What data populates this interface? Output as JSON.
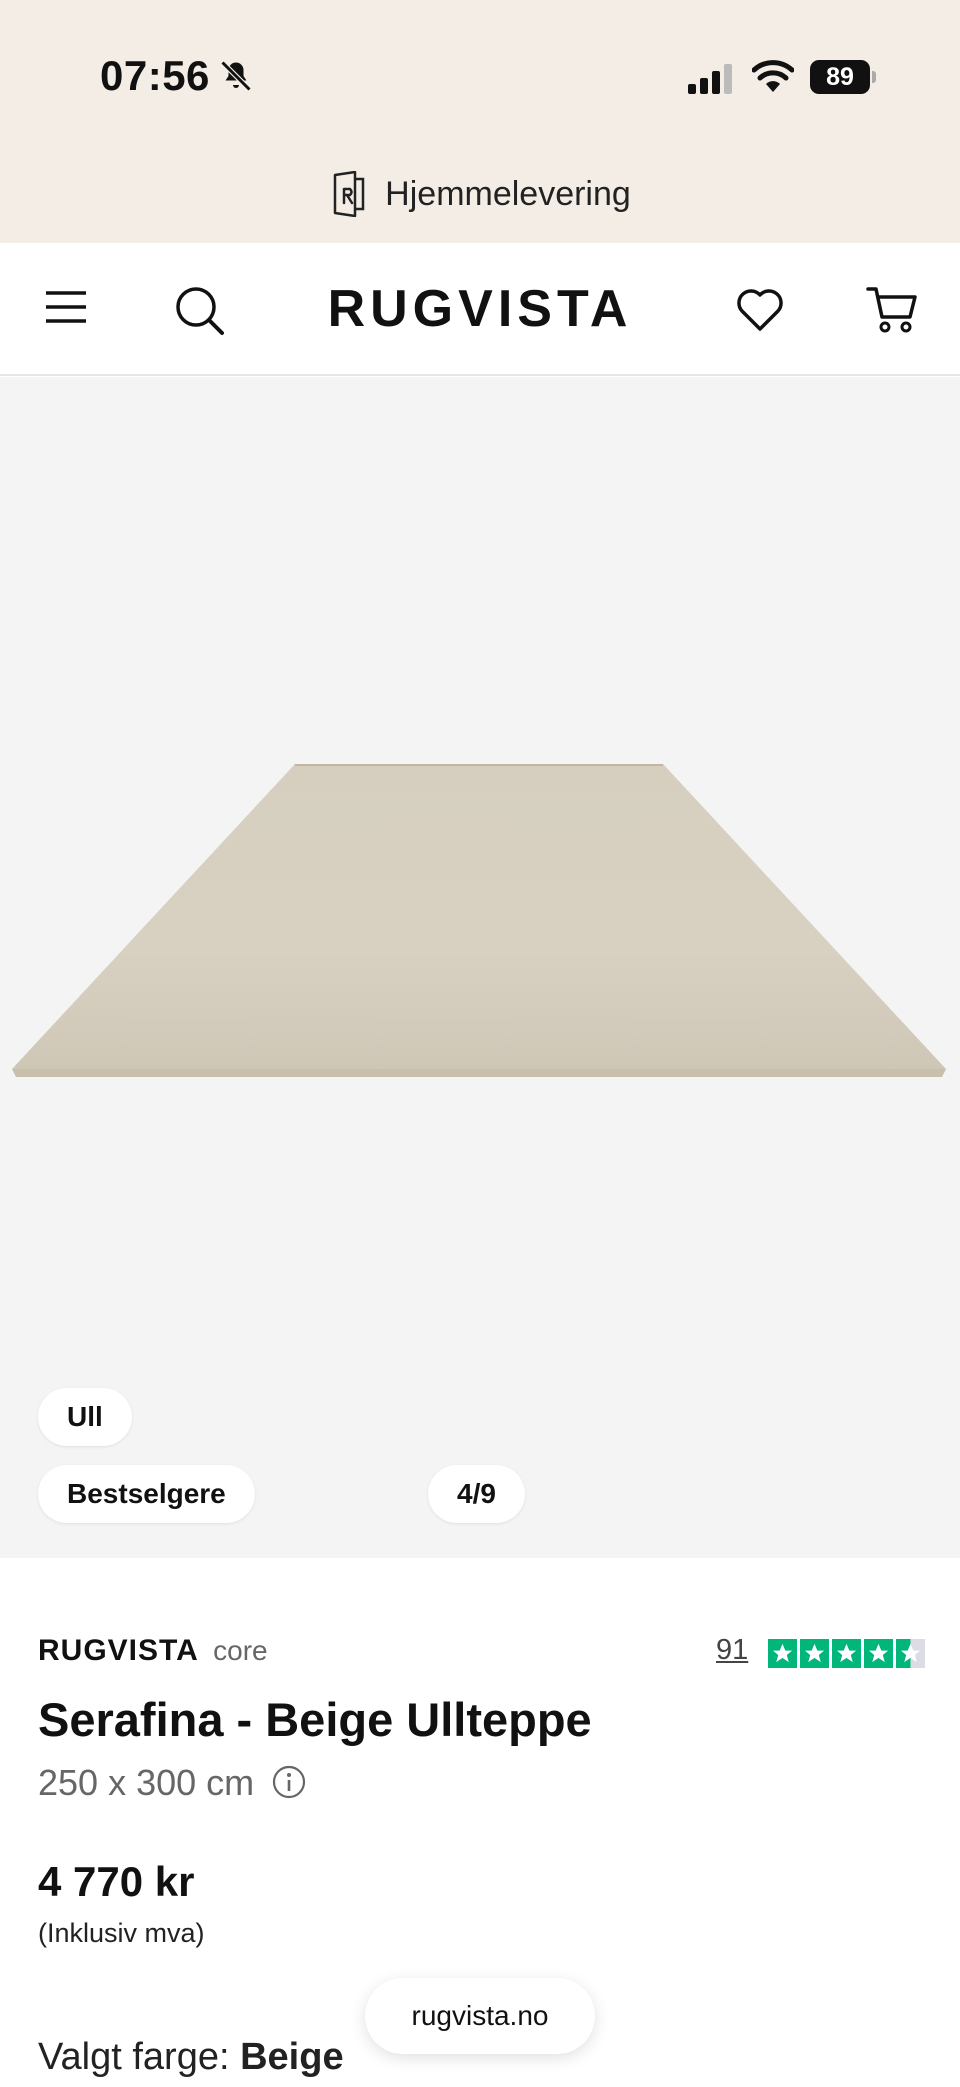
{
  "status_bar": {
    "time": "07:56",
    "battery": "89"
  },
  "banner": {
    "delivery_label": "Hjemmelevering"
  },
  "header": {
    "logo": "RUGVISTA"
  },
  "gallery": {
    "chips": [
      "Ull",
      "Bestselgere"
    ],
    "counter": "4/9"
  },
  "product": {
    "brand": "RUGVISTA",
    "line": "core",
    "review_count": "91",
    "rating_stars": 4.5,
    "title": "Serafina - Beige Ullteppe",
    "size": "250 x 300 cm",
    "price": "4 770 kr",
    "vat_note": "(Inklusiv mva)",
    "color_label": "Valgt farge:",
    "color_value": "Beige"
  },
  "browser": {
    "url": "rugvista.no"
  },
  "colors": {
    "banner_bg": "#f3ede6",
    "gallery_bg": "#f4f4f4",
    "trustpilot_green": "#00b67a",
    "rug": "#d8d1c2"
  }
}
